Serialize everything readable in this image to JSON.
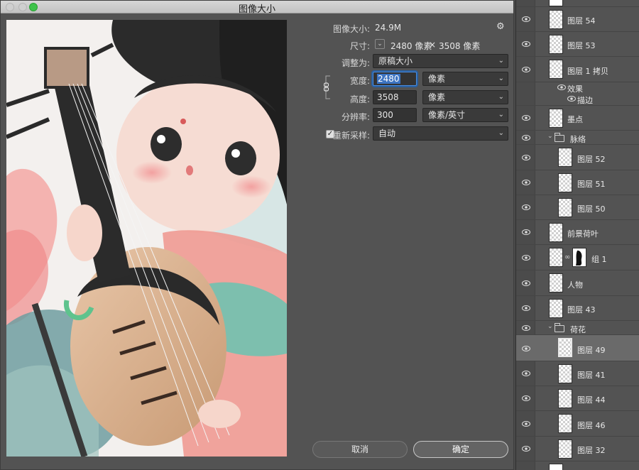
{
  "dialog": {
    "title": "图像大小",
    "image_size_label": "图像大小:",
    "image_size_value": "24.9M",
    "dimensions_label": "尺寸:",
    "dimensions_width": "2480 像素",
    "dimensions_times": "×",
    "dimensions_height": "3508 像素",
    "fit_label": "调整为:",
    "fit_value": "原稿大小",
    "width_label": "宽度:",
    "width_value": "2480",
    "width_unit": "像素",
    "height_label": "高度:",
    "height_value": "3508",
    "height_unit": "像素",
    "resolution_label": "分辨率:",
    "resolution_value": "300",
    "resolution_unit": "像素/英寸",
    "resample_label": "重新采样:",
    "resample_checked": true,
    "resample_value": "自动",
    "cancel_label": "取消",
    "ok_label": "确定",
    "gear_glyph": "⚙",
    "check_glyph": "✓",
    "chevron_glyph": "⌄",
    "dropdown_glyph": "⌄"
  },
  "layers": [
    {
      "name": "图层 54",
      "type": "layer"
    },
    {
      "name": "图层 53",
      "type": "layer"
    },
    {
      "name": "图层 1 拷贝",
      "type": "layer"
    },
    {
      "name": "效果",
      "type": "effect"
    },
    {
      "name": "描边",
      "type": "effect"
    },
    {
      "name": "墨点",
      "type": "layer"
    },
    {
      "name": "脉络",
      "type": "group"
    },
    {
      "name": "图层 52",
      "type": "layer"
    },
    {
      "name": "图层 51",
      "type": "layer"
    },
    {
      "name": "图层 50",
      "type": "layer"
    },
    {
      "name": "前景荷叶",
      "type": "layer"
    },
    {
      "name": "组 1",
      "type": "layer"
    },
    {
      "name": "人物",
      "type": "layer"
    },
    {
      "name": "图层 43",
      "type": "layer"
    },
    {
      "name": "荷花",
      "type": "group"
    },
    {
      "name": "图层 49",
      "type": "layer",
      "selected": true
    },
    {
      "name": "图层 41",
      "type": "layer"
    },
    {
      "name": "图层 44",
      "type": "layer"
    },
    {
      "name": "图层 46",
      "type": "layer"
    },
    {
      "name": "图层 32",
      "type": "layer"
    }
  ],
  "colors": {
    "accent": "#3d74c2",
    "traffic_green": "#3dc34a",
    "panel": "#535353"
  }
}
